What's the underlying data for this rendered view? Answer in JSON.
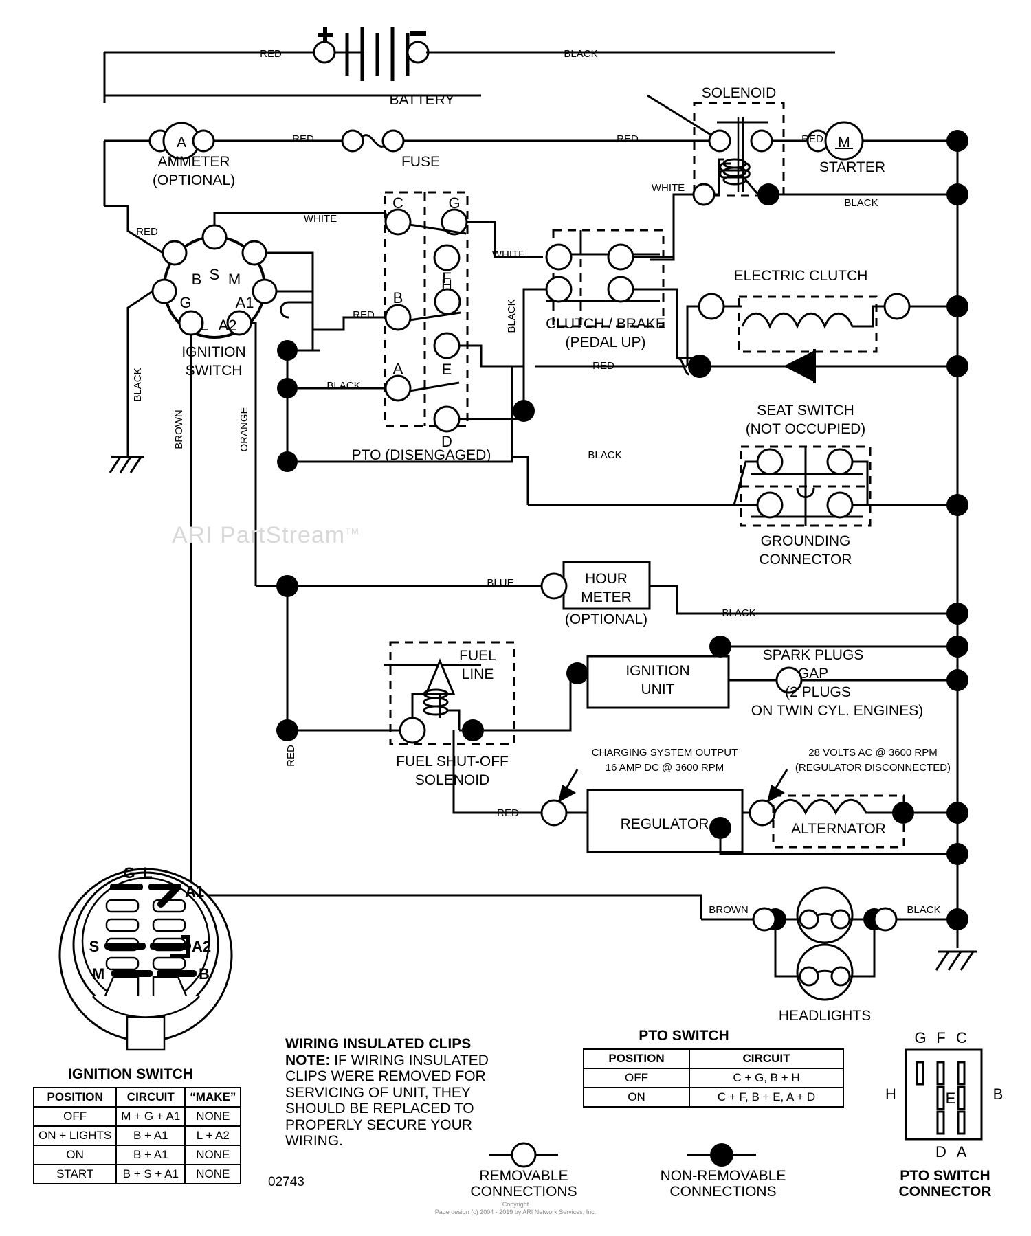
{
  "diagram": {
    "part_number": "02743",
    "watermark": "ARI PartStream",
    "watermark_tm": "TM",
    "copyright_line1": "Copyright",
    "copyright_line2": "Page design (c) 2004 - 2019 by ARI Network Services, Inc."
  },
  "components": {
    "battery": "BATTERY",
    "battery_plus": "+",
    "battery_minus": "–",
    "ammeter": "AMMETER",
    "ammeter_sub": "(OPTIONAL)",
    "ammeter_symbol": "A",
    "fuse": "FUSE",
    "solenoid": "SOLENOID",
    "starter": "STARTER",
    "starter_symbol": "M",
    "ignition_switch": "IGNITION",
    "ignition_switch2": "SWITCH",
    "pto": "PTO (DISENGAGED)",
    "clutch_brake": "CLUTCH / BRAKE",
    "clutch_brake_sub": "(PEDAL UP)",
    "electric_clutch": "ELECTRIC CLUTCH",
    "seat_switch": "SEAT SWITCH",
    "seat_switch_sub": "(NOT OCCUPIED)",
    "grounding": "GROUNDING",
    "grounding2": "CONNECTOR",
    "hour_meter1": "HOUR",
    "hour_meter2": "METER",
    "hour_meter_sub": "(OPTIONAL)",
    "fuel_line1": "FUEL",
    "fuel_line2": "LINE",
    "fuel_solenoid1": "FUEL SHUT-OFF",
    "fuel_solenoid2": "SOLENOID",
    "ignition_unit1": "IGNITION",
    "ignition_unit2": "UNIT",
    "spark1": "SPARK PLUGS",
    "spark2": "GAP",
    "spark3": "(2 PLUGS",
    "spark4": "ON TWIN CYL. ENGINES)",
    "regulator": "REGULATOR",
    "alternator": "ALTERNATOR",
    "headlights": "HEADLIGHTS"
  },
  "annotations": {
    "charging1": "CHARGING SYSTEM OUTPUT",
    "charging2": "16 AMP DC @ 3600 RPM",
    "alt_out1": "28 VOLTS AC @ 3600 RPM",
    "alt_out2": "(REGULATOR DISCONNECTED)"
  },
  "wire_labels": {
    "red": "RED",
    "black": "BLACK",
    "white": "WHITE",
    "blue": "BLUE",
    "brown": "BROWN",
    "orange": "ORANGE"
  },
  "terminals": {
    "ignition": [
      "S",
      "B",
      "M",
      "G",
      "A1",
      "L",
      "A2"
    ],
    "pto": [
      "C",
      "G",
      "F",
      "H",
      "B",
      "E",
      "A",
      "D"
    ],
    "connector_top": [
      "G",
      "F",
      "C"
    ],
    "connector_mid_left": "E",
    "connector_right": "B",
    "connector_left": "H",
    "connector_bottom": [
      "D",
      "A"
    ]
  },
  "ignition_switch_detail": {
    "labels": [
      "G",
      "L",
      "A1",
      "S",
      "A2",
      "M",
      "B"
    ],
    "caption": "IGNITION SWITCH"
  },
  "ignition_table": {
    "title": "IGNITION SWITCH",
    "headers": [
      "POSITION",
      "CIRCUIT",
      "“MAKE”"
    ],
    "rows": [
      [
        "OFF",
        "M + G + A1",
        "NONE"
      ],
      [
        "ON + LIGHTS",
        "B + A1",
        "L + A2"
      ],
      [
        "ON",
        "B + A1",
        "NONE"
      ],
      [
        "START",
        "B + S + A1",
        "NONE"
      ]
    ]
  },
  "pto_table": {
    "title": "PTO SWITCH",
    "headers": [
      "POSITION",
      "CIRCUIT"
    ],
    "rows": [
      [
        "OFF",
        "C + G, B + H"
      ],
      [
        "ON",
        "C + F, B + E, A + D"
      ]
    ]
  },
  "note": {
    "title": "WIRING INSULATED CLIPS",
    "label": "NOTE:",
    "lines": [
      " IF WIRING INSULATED",
      "CLIPS WERE REMOVED FOR",
      "SERVICING OF UNIT, THEY",
      "SHOULD BE REPLACED TO",
      "PROPERLY SECURE YOUR",
      "WIRING."
    ]
  },
  "legend": {
    "removable1": "REMOVABLE",
    "removable2": "CONNECTIONS",
    "nonremovable1": "NON-REMOVABLE",
    "nonremovable2": "CONNECTIONS",
    "connector1": "PTO SWITCH",
    "connector2": "CONNECTOR"
  }
}
